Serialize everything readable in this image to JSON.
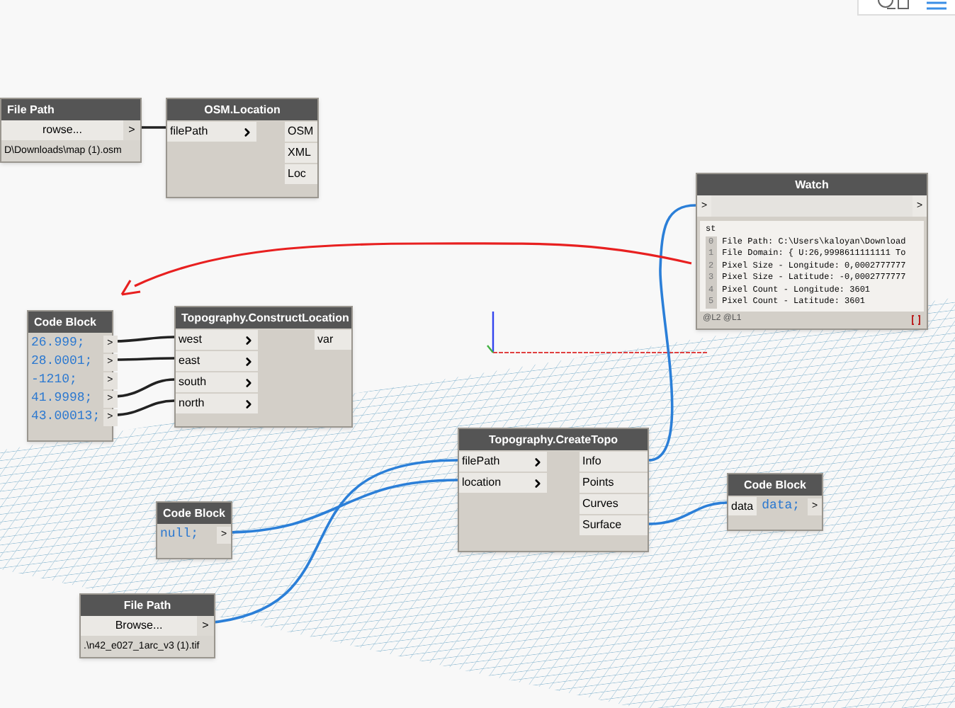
{
  "nodes": [
    {
      "kind": "file_path",
      "title": "File Path",
      "button": "rowse...",
      "port": ">",
      "path": "D\\Downloads\\map (1).osm"
    },
    {
      "kind": "function",
      "title": "OSM.Location",
      "inputs": [
        "filePath"
      ],
      "outputs": [
        "OSM",
        "XML",
        "Loc"
      ]
    },
    {
      "kind": "watch",
      "title": "Watch",
      "in_port": ">",
      "out_port": ">",
      "list_head": "st",
      "items": [
        {
          "index": "0",
          "text": "File Path: C:\\Users\\kaloyan\\Download"
        },
        {
          "index": "1",
          "text": "File Domain: { U:26,9998611111111 To"
        },
        {
          "index": "2",
          "text": "Pixel Size - Longitude: 0,0002777777"
        },
        {
          "index": "3",
          "text": "Pixel Size - Latitude: -0,0002777777"
        },
        {
          "index": "4",
          "text": "Pixel Count - Longitude: 3601"
        },
        {
          "index": "5",
          "text": "Pixel Count - Latitude: 3601"
        }
      ],
      "footer": "@L2 @L1"
    },
    {
      "kind": "code_block",
      "title": "Code Block",
      "lines": [
        "26.999;",
        "28.0001;",
        "-1210;",
        "41.9998;",
        "43.00013;"
      ],
      "port": ">"
    },
    {
      "kind": "function",
      "title": "Topography.ConstructLocation",
      "inputs": [
        "west",
        "east",
        "south",
        "north"
      ],
      "outputs": [
        "var"
      ]
    },
    {
      "kind": "function",
      "title": "Topography.CreateTopo",
      "inputs": [
        "filePath",
        "location"
      ],
      "outputs": [
        "Info",
        "Points",
        "Curves",
        "Surface"
      ]
    },
    {
      "kind": "code_block",
      "title": "Code Block",
      "lines": [
        "null;"
      ],
      "port": ">"
    },
    {
      "kind": "file_path",
      "title": "File Path",
      "button": "Browse...",
      "port": ">",
      "path": ".\\n42_e027_1arc_v3 (1).tif"
    },
    {
      "kind": "code_block",
      "title": "Code Block",
      "inputs": [
        "data"
      ],
      "lines": [
        "data;"
      ],
      "port": ">"
    }
  ]
}
